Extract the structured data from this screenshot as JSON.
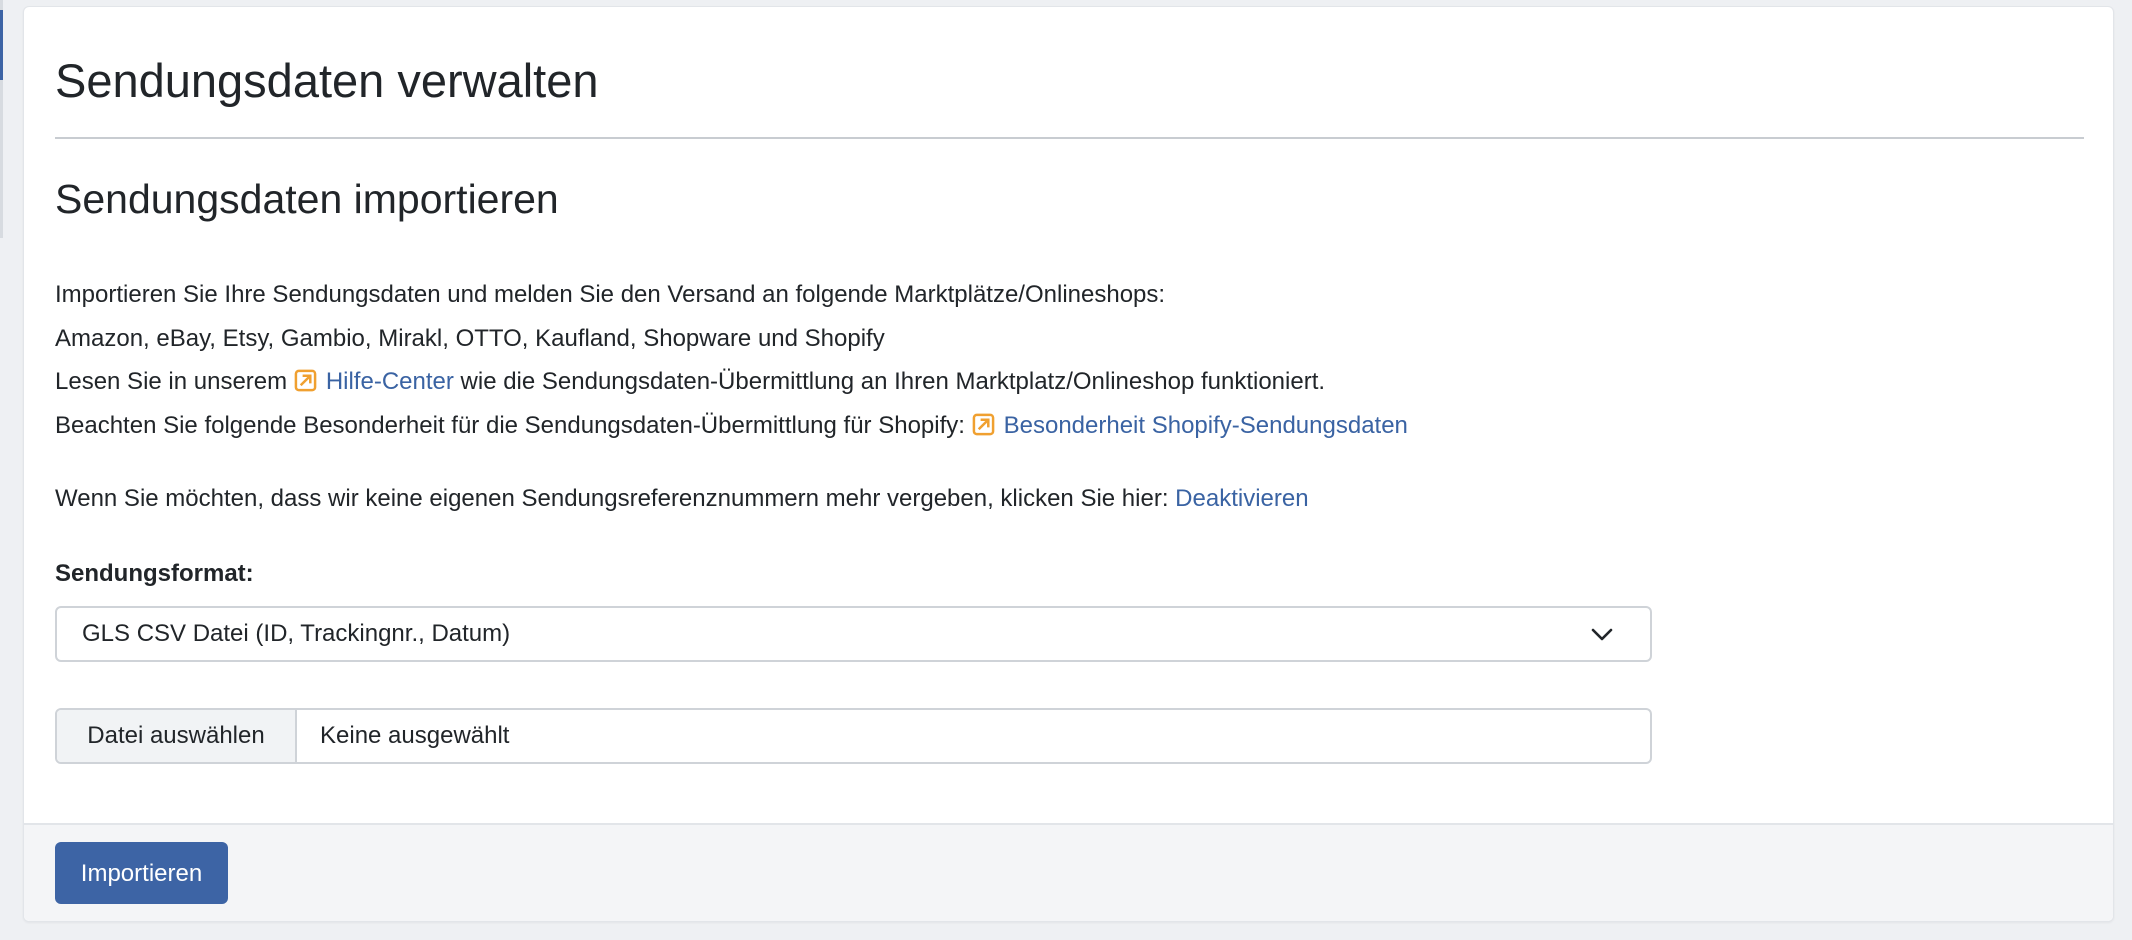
{
  "page_title": "Sendungsdaten verwalten",
  "section_title": "Sendungsdaten importieren",
  "intro": {
    "line1": "Importieren Sie Ihre Sendungsdaten und melden Sie den Versand an folgende Marktplätze/Onlineshops:",
    "line2": "Amazon, eBay, Etsy, Gambio, Mirakl, OTTO, Kaufland, Shopware und Shopify",
    "line3_prefix": "Lesen Sie in unserem",
    "help_center_link": "Hilfe-Center",
    "line3_suffix": "wie die Sendungsdaten-Übermittlung an Ihren Marktplatz/Onlineshop funktioniert.",
    "line4_prefix": "Beachten Sie folgende Besonderheit für die Sendungsdaten-Übermittlung für Shopify:",
    "shopify_link": "Besonderheit Shopify-Sendungsdaten"
  },
  "deactivate": {
    "text": "Wenn Sie möchten, dass wir keine eigenen Sendungsreferenznummern mehr vergeben, klicken Sie hier:",
    "link": "Deaktivieren"
  },
  "format": {
    "label": "Sendungsformat:",
    "selected": "GLS CSV Datei (ID, Trackingnr., Datum)"
  },
  "file": {
    "button_label": "Datei auswählen",
    "status": "Keine ausgewählt"
  },
  "footer": {
    "import_label": "Importieren"
  },
  "colors": {
    "link": "#3a63a3",
    "primary_button": "#3d64a5",
    "external_icon": "#f0a030"
  },
  "icons": {
    "external": "external-link-icon",
    "select": "chevron-down-icon"
  }
}
